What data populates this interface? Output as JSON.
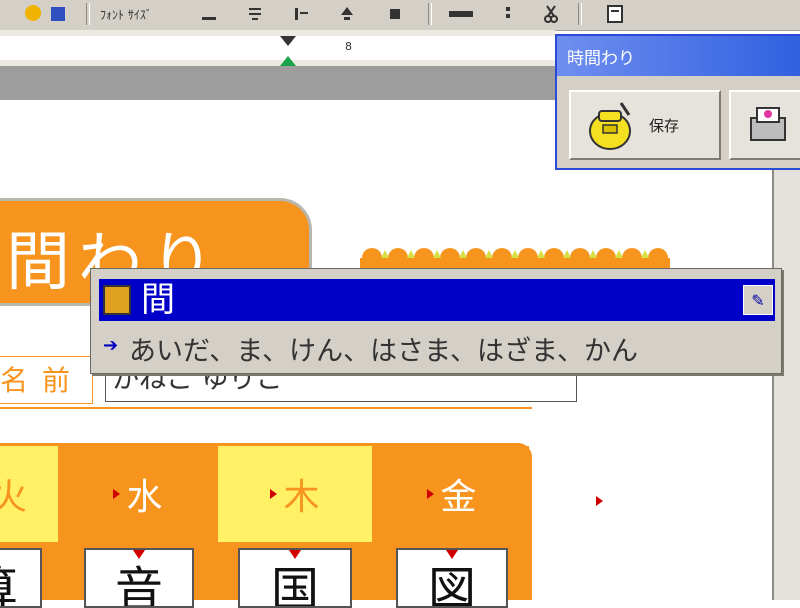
{
  "toolbar": {
    "icons": [
      "logo-icon",
      "font-size-icon",
      "underline-icon",
      "align-icon",
      "indent-icon",
      "sort-icon",
      "bullets-icon",
      "format-icon",
      "table-icon",
      "scissors-icon",
      "page-icon"
    ]
  },
  "ruler": {
    "number": "8"
  },
  "palette": {
    "title": "時間わり",
    "save_label": "保存",
    "colors": {
      "title_bar": "#3060e0",
      "face": "#d4d0c8"
    }
  },
  "document": {
    "title": "間わり",
    "name_label": "名前",
    "name_value": "かねこ ゆりこ",
    "accent_color": "#f7941d"
  },
  "ime": {
    "kanji": "間",
    "readings": "あいだ、ま、けん、はさま、はざま、かん"
  },
  "timetable": {
    "days": [
      "火",
      "水",
      "木",
      "金"
    ],
    "subjects": [
      "算",
      "音",
      "国",
      "図"
    ],
    "colors": {
      "header_orange": "#f7941d",
      "header_yellow": "#fff066"
    }
  }
}
